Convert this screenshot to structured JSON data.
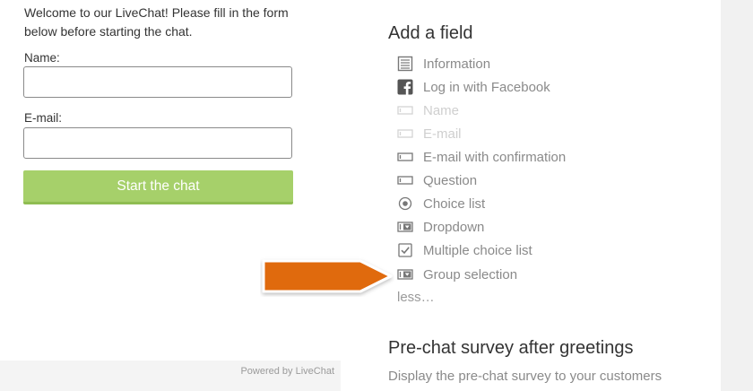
{
  "preview": {
    "welcome": "Welcome to our LiveChat! Please fill in the form below before starting the chat.",
    "name_label": "Name:",
    "email_label": "E-mail:",
    "start_button": "Start the chat",
    "powered_by": "Powered by LiveChat"
  },
  "settings": {
    "add_field_title": "Add a field",
    "fields": [
      {
        "label": "Information",
        "icon": "information-icon",
        "disabled": false
      },
      {
        "label": "Log in with Facebook",
        "icon": "facebook-icon",
        "disabled": false
      },
      {
        "label": "Name",
        "icon": "text-field-icon",
        "disabled": true
      },
      {
        "label": "E-mail",
        "icon": "text-field-icon",
        "disabled": true
      },
      {
        "label": "E-mail with confirmation",
        "icon": "text-field-icon",
        "disabled": false
      },
      {
        "label": "Question",
        "icon": "text-field-icon",
        "disabled": false
      },
      {
        "label": "Choice list",
        "icon": "radio-icon",
        "disabled": false
      },
      {
        "label": "Dropdown",
        "icon": "dropdown-icon",
        "disabled": false
      },
      {
        "label": "Multiple choice list",
        "icon": "checkbox-icon",
        "disabled": false
      },
      {
        "label": "Group selection",
        "icon": "dropdown-icon",
        "disabled": false
      }
    ],
    "less_link": "less…",
    "prechat_title": "Pre-chat survey after greetings",
    "prechat_desc": "Display the pre-chat survey to your customers"
  },
  "colors": {
    "start_button": "#a6d06a",
    "arrow": "#e06a10",
    "facebook_icon": "#555555"
  }
}
